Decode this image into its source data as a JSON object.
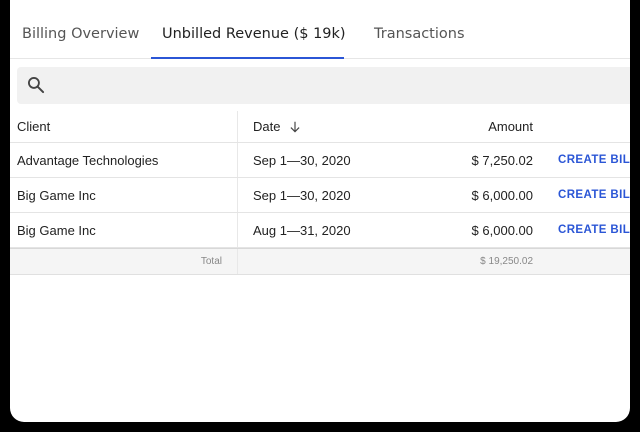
{
  "tabs": [
    {
      "label": "Billing Overview",
      "active": false
    },
    {
      "label": "Unbilled Revenue ($ 19k)",
      "active": true
    },
    {
      "label": "Transactions",
      "active": false
    }
  ],
  "search": {
    "placeholder": "",
    "value": ""
  },
  "table": {
    "columns": {
      "client": "Client",
      "date": "Date",
      "amount": "Amount"
    },
    "rows": [
      {
        "client": "Advantage Technologies",
        "date": "Sep 1—30, 2020",
        "amount": "$ 7,250.02",
        "action": "CREATE BILL"
      },
      {
        "client": "Big Game Inc",
        "date": "Sep 1—30, 2020",
        "amount": "$ 6,000.00",
        "action": "CREATE BILL"
      },
      {
        "client": "Big Game Inc",
        "date": "Aug 1—31, 2020",
        "amount": "$ 6,000.00",
        "action": "CREATE BILL"
      }
    ],
    "total": {
      "label": "Total",
      "amount": "$ 19,250.02"
    }
  },
  "colors": {
    "accent": "#2b56d6"
  }
}
